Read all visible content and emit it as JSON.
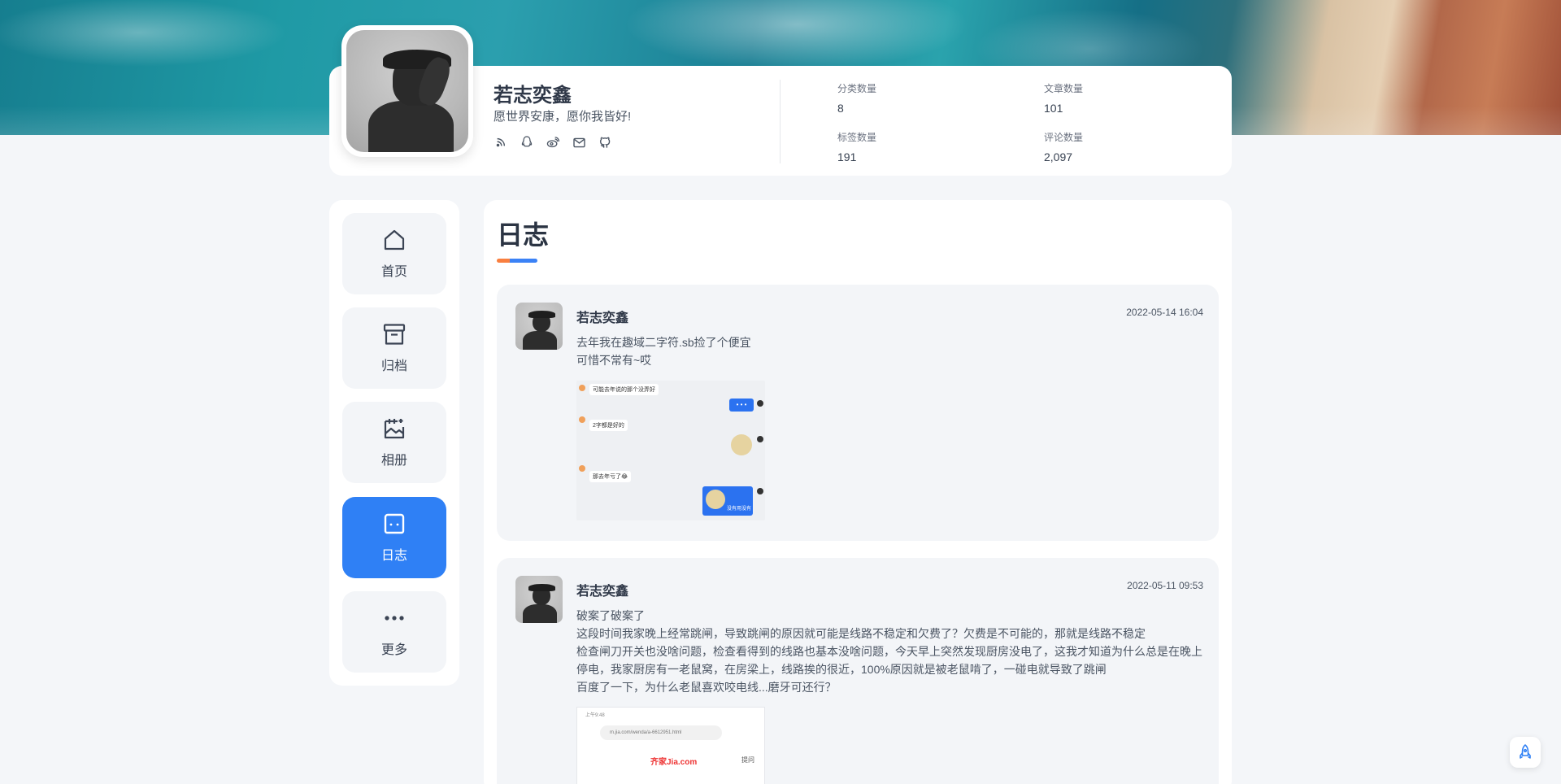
{
  "profile": {
    "name": "若志奕鑫",
    "motto": "愿世界安康，愿你我皆好!",
    "social_icons": [
      "rss-icon",
      "qq-icon",
      "weibo-icon",
      "mail-icon",
      "github-icon"
    ],
    "stats": [
      {
        "label": "分类数量",
        "value": "8"
      },
      {
        "label": "文章数量",
        "value": "101"
      },
      {
        "label": "标签数量",
        "value": "191"
      },
      {
        "label": "评论数量",
        "value": "2,097"
      }
    ]
  },
  "nav": {
    "items": [
      {
        "label": "首页",
        "icon": "home-icon"
      },
      {
        "label": "归档",
        "icon": "archive-icon"
      },
      {
        "label": "相册",
        "icon": "album-icon"
      },
      {
        "label": "日志",
        "icon": "journal-icon",
        "active": true
      },
      {
        "label": "更多",
        "icon": "more-icon"
      }
    ]
  },
  "page": {
    "title": "日志"
  },
  "posts": [
    {
      "author": "若志奕鑫",
      "time": "2022-05-14 16:04",
      "lines": [
        "去年我在趣域二字符.sb捡了个便宜",
        "可惜不常有~哎"
      ],
      "screenshot": {
        "bubble_1": "可能去年说的那个没弄好",
        "bubble_2": "2字都是好的",
        "bubble_3": "那去年亏了😂",
        "blue_1": "• • •",
        "blue_2": "没有用没有"
      }
    },
    {
      "author": "若志奕鑫",
      "time": "2022-05-11 09:53",
      "lines": [
        "破案了破案了",
        "这段时间我家晚上经常跳闸，导致跳闸的原因就可能是线路不稳定和欠费了？欠费是不可能的，那就是线路不稳定",
        "检查闸刀开关也没啥问题，检查看得到的线路也基本没啥问题，今天早上突然发现厨房没电了，这我才知道为什么总是在晚上",
        "停电，我家厨房有一老鼠窝，在房梁上，线路挨的很近，100%原因就是被老鼠啃了，一碰电就导致了跳闸",
        "百度了一下，为什么老鼠喜欢咬电线...磨牙可还行？"
      ],
      "screenshot": {
        "status": "上午9:48",
        "url": "m.jia.com/wenda/a-6612951.html",
        "brand": "齐家Jia.com",
        "ask": "提问"
      }
    }
  ],
  "colors": {
    "accent": "#2f80f5",
    "accent_orange": "#f97f3f"
  }
}
